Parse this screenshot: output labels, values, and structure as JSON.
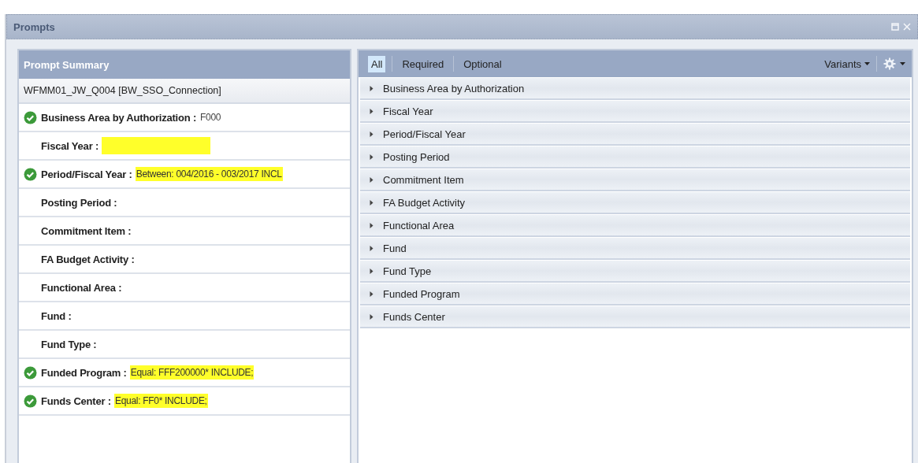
{
  "window": {
    "title": "Prompts"
  },
  "summary": {
    "title": "Prompt Summary",
    "connection": "WFMM01_JW_Q004 [BW_SSO_Connection]",
    "items": [
      {
        "label": "Business Area by Authorization :",
        "value": "F000",
        "done": true,
        "highlighted": false
      },
      {
        "label": "Fiscal Year :",
        "done": false,
        "highlighted": true
      },
      {
        "label": "Period/Fiscal Year :",
        "value": "Between: 004/2016 - 003/2017 INCL",
        "done": true,
        "highlighted": true
      },
      {
        "label": "Posting Period :",
        "done": false,
        "highlighted": false
      },
      {
        "label": "Commitment Item :",
        "done": false,
        "highlighted": false
      },
      {
        "label": "FA Budget Activity :",
        "done": false,
        "highlighted": false
      },
      {
        "label": "Functional Area :",
        "done": false,
        "highlighted": false
      },
      {
        "label": "Fund :",
        "done": false,
        "highlighted": false
      },
      {
        "label": "Fund Type :",
        "done": false,
        "highlighted": false
      },
      {
        "label": "Funded Program :",
        "value": "Equal: FFF200000* INCLUDE;",
        "done": true,
        "highlighted": true
      },
      {
        "label": "Funds Center :",
        "value": "Equal: FF0* INCLUDE;",
        "done": true,
        "highlighted": true
      }
    ]
  },
  "filters": {
    "tabs": [
      {
        "label": "All",
        "selected": true
      },
      {
        "label": "Required",
        "selected": false
      },
      {
        "label": "Optional",
        "selected": false
      }
    ],
    "variants": "Variants",
    "prompts": [
      {
        "label": "Business Area by Authorization",
        "expanded": false
      },
      {
        "label": "Fiscal Year",
        "expanded": false
      },
      {
        "label": "Period/Fiscal Year",
        "expanded": false
      },
      {
        "label": "Posting Period",
        "expanded": false
      },
      {
        "label": "Commitment Item",
        "expanded": false
      },
      {
        "label": "FA Budget Activity",
        "expanded": false
      },
      {
        "label": "Functional Area",
        "expanded": false
      },
      {
        "label": "Fund",
        "expanded": false
      },
      {
        "label": "Fund Type",
        "expanded": false
      },
      {
        "label": "Funded Program",
        "expanded": false
      },
      {
        "label": "Funds Center",
        "expanded": false
      }
    ]
  }
}
